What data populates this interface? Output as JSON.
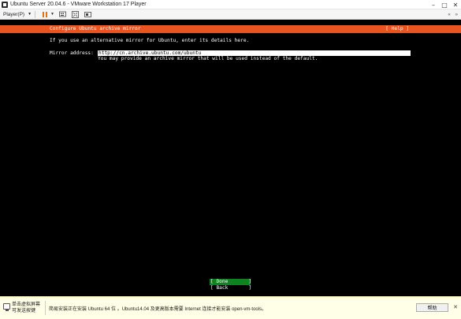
{
  "window": {
    "title": "Ubuntu Server 20.04.6 - VMware Workstation 17 Player",
    "controls": {
      "minimize": "–",
      "maximize": "□",
      "close": "✕"
    }
  },
  "toolbar": {
    "player_menu": "Player(P)",
    "icons": [
      "pause-icon",
      "send-ctrl-alt-del-icon",
      "fit-guest-icon",
      "fullscreen-icon",
      "unity-icon"
    ],
    "right_icons": [
      "back-arrows-icon",
      "expand-icon"
    ],
    "accent_color": "#e8700c"
  },
  "installer": {
    "header_title": "Configure Ubuntu archive mirror",
    "header_help": "[ Help ]",
    "header_color": "#e95420",
    "intro": "If you use an alternative mirror for Ubuntu, enter its details here.",
    "mirror_label": "Mirror address:",
    "mirror_value": "http://cn.archive.ubuntu.com/ubuntu",
    "mirror_help": "You may provide an archive mirror that will be used instead of the default.",
    "done_label": "[ Done       ]",
    "back_label": "[ Back       ]",
    "done_color": "#0e8420"
  },
  "notification": {
    "click_text_line1": "单击虚拟屏幕",
    "click_text_line2": "可发送按键",
    "message": "简易安装正在安装 Ubuntu 64 位 。Ubuntu14.04 及更高版本需要 Internet 连接才能安装 open-vm-tools。",
    "help_button": "帮助",
    "close": "✕"
  }
}
